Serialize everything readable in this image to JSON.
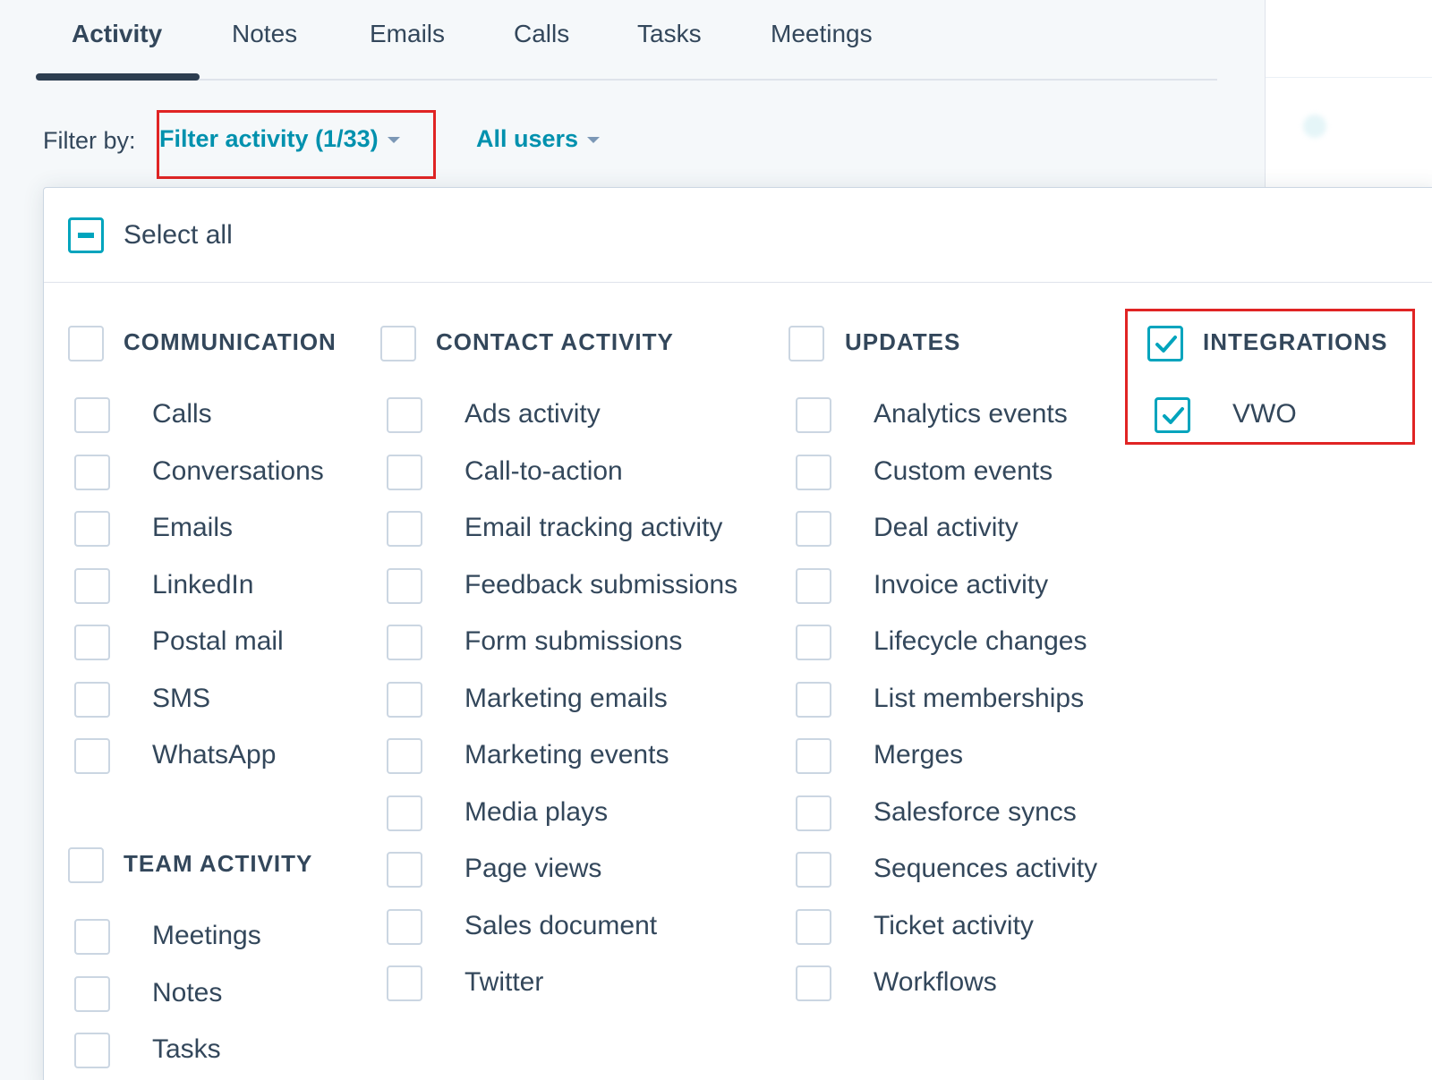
{
  "tabs": [
    {
      "label": "Activity",
      "active": true
    },
    {
      "label": "Notes"
    },
    {
      "label": "Emails"
    },
    {
      "label": "Calls"
    },
    {
      "label": "Tasks"
    },
    {
      "label": "Meetings"
    }
  ],
  "filter": {
    "label": "Filter by:",
    "activity_button": "Filter activity (1/33)",
    "users_button": "All users"
  },
  "select_all": "Select all",
  "colors": {
    "accent": "#0091ae",
    "checkbox_checked": "#00a4bd",
    "highlight": "#e02424",
    "text": "#33475b"
  },
  "categories": {
    "communication": {
      "title": "COMMUNICATION",
      "checked": false,
      "items": [
        "Calls",
        "Conversations",
        "Emails",
        "LinkedIn",
        "Postal mail",
        "SMS",
        "WhatsApp"
      ]
    },
    "team_activity": {
      "title": "TEAM ACTIVITY",
      "checked": false,
      "items": [
        "Meetings",
        "Notes",
        "Tasks"
      ]
    },
    "contact_activity": {
      "title": "CONTACT ACTIVITY",
      "checked": false,
      "items": [
        "Ads activity",
        "Call-to-action",
        "Email tracking activity",
        "Feedback submissions",
        "Form submissions",
        "Marketing emails",
        "Marketing events",
        "Media plays",
        "Page views",
        "Sales document",
        "Twitter"
      ]
    },
    "updates": {
      "title": "UPDATES",
      "checked": false,
      "items": [
        "Analytics events",
        "Custom events",
        "Deal activity",
        "Invoice activity",
        "Lifecycle changes",
        "List memberships",
        "Merges",
        "Salesforce syncs",
        "Sequences activity",
        "Ticket activity",
        "Workflows"
      ]
    },
    "integrations": {
      "title": "INTEGRATIONS",
      "checked": true,
      "items": [
        "VWO"
      ],
      "items_checked": [
        true
      ]
    }
  }
}
